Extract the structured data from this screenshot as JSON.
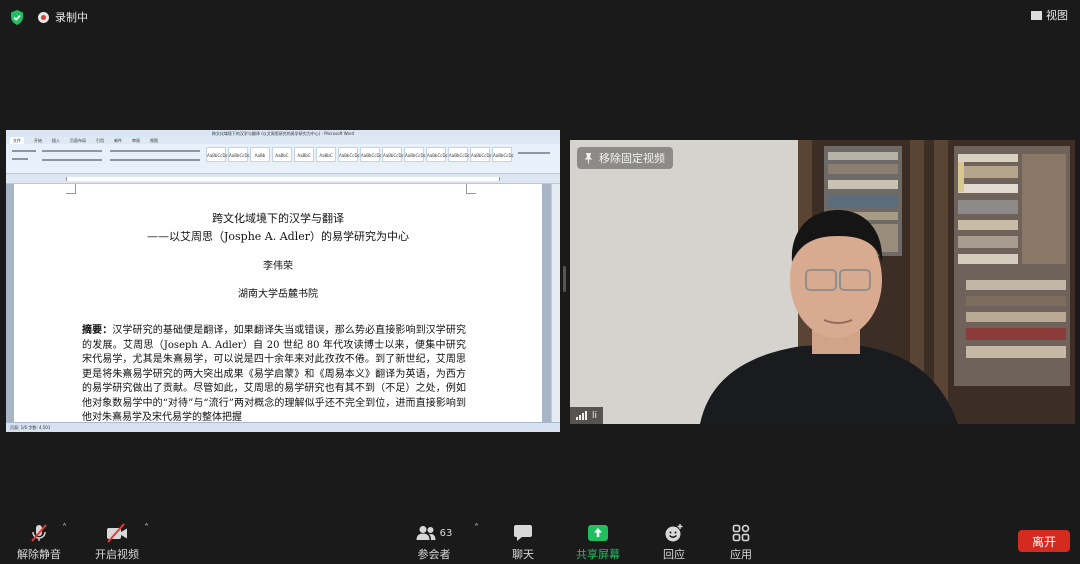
{
  "topbar": {
    "recording_label": "录制中",
    "view_label": "视图"
  },
  "shared_screen": {
    "window_title": "跨文化域境下的汉学与翻译 (以艾周思研究的易学研究为中心) - Microsoft Word",
    "ribbon_tabs": [
      "文件",
      "开始",
      "插入",
      "页面布局",
      "引用",
      "邮件",
      "审阅",
      "视图"
    ],
    "styles": [
      "AaBbCcDc",
      "AaBbCcDc",
      "AaBb",
      "AaBbC",
      "AaBbC",
      "AaBbC",
      "AaBbCcDc",
      "AaBbCcDc",
      "AaBbCcDc",
      "AaBbCcDc",
      "AaBbCcDc",
      "AaBbCcDc",
      "AaBbCcDc",
      "AaBbCcDc"
    ],
    "status_text": "页面: 1/6   字数: 4,501",
    "document": {
      "title": "跨文化域境下的汉学与翻译",
      "subtitle": "——以艾周思（Josphe A. Adler）的易学研究为中心",
      "author": "李伟荣",
      "affiliation": "湖南大学岳麓书院",
      "abstract_label": "摘要：",
      "abstract_text": "汉学研究的基础便是翻译，如果翻译失当或错误，那么势必直接影响到汉学研究的发展。艾周思（Joseph A. Adler）自 20 世纪 80 年代攻读博士以来，便集中研究宋代易学，尤其是朱熹易学，可以说是四十余年来对此孜孜不倦。到了新世纪，艾周思更是将朱熹易学研究的两大突出成果《易学启蒙》和《周易本义》翻译为英语，为西方的易学研究做出了贡献。尽管如此，艾周思的易学研究也有其不到（不足）之处，例如他对象数易学中的“对待”与“流行”两对概念的理解似乎还不完全到位，进而直接影响到他对朱熹易学及宋代易学的整体把握"
    }
  },
  "video": {
    "unpin_label": "移除固定视频",
    "participant_label": "li"
  },
  "toolbar": {
    "unmute_label": "解除静音",
    "start_video_label": "开启视频",
    "participants_label": "参会者",
    "participants_count": "63",
    "chat_label": "聊天",
    "share_label": "共享屏幕",
    "reactions_label": "回应",
    "apps_label": "应用",
    "leave_label": "离开"
  },
  "colors": {
    "background": "#1a1a1a",
    "share_green": "#1fbf5f",
    "leave_red": "#d52b1e",
    "shield_green": "#1fbf5f",
    "record_red": "#e23b3b"
  }
}
